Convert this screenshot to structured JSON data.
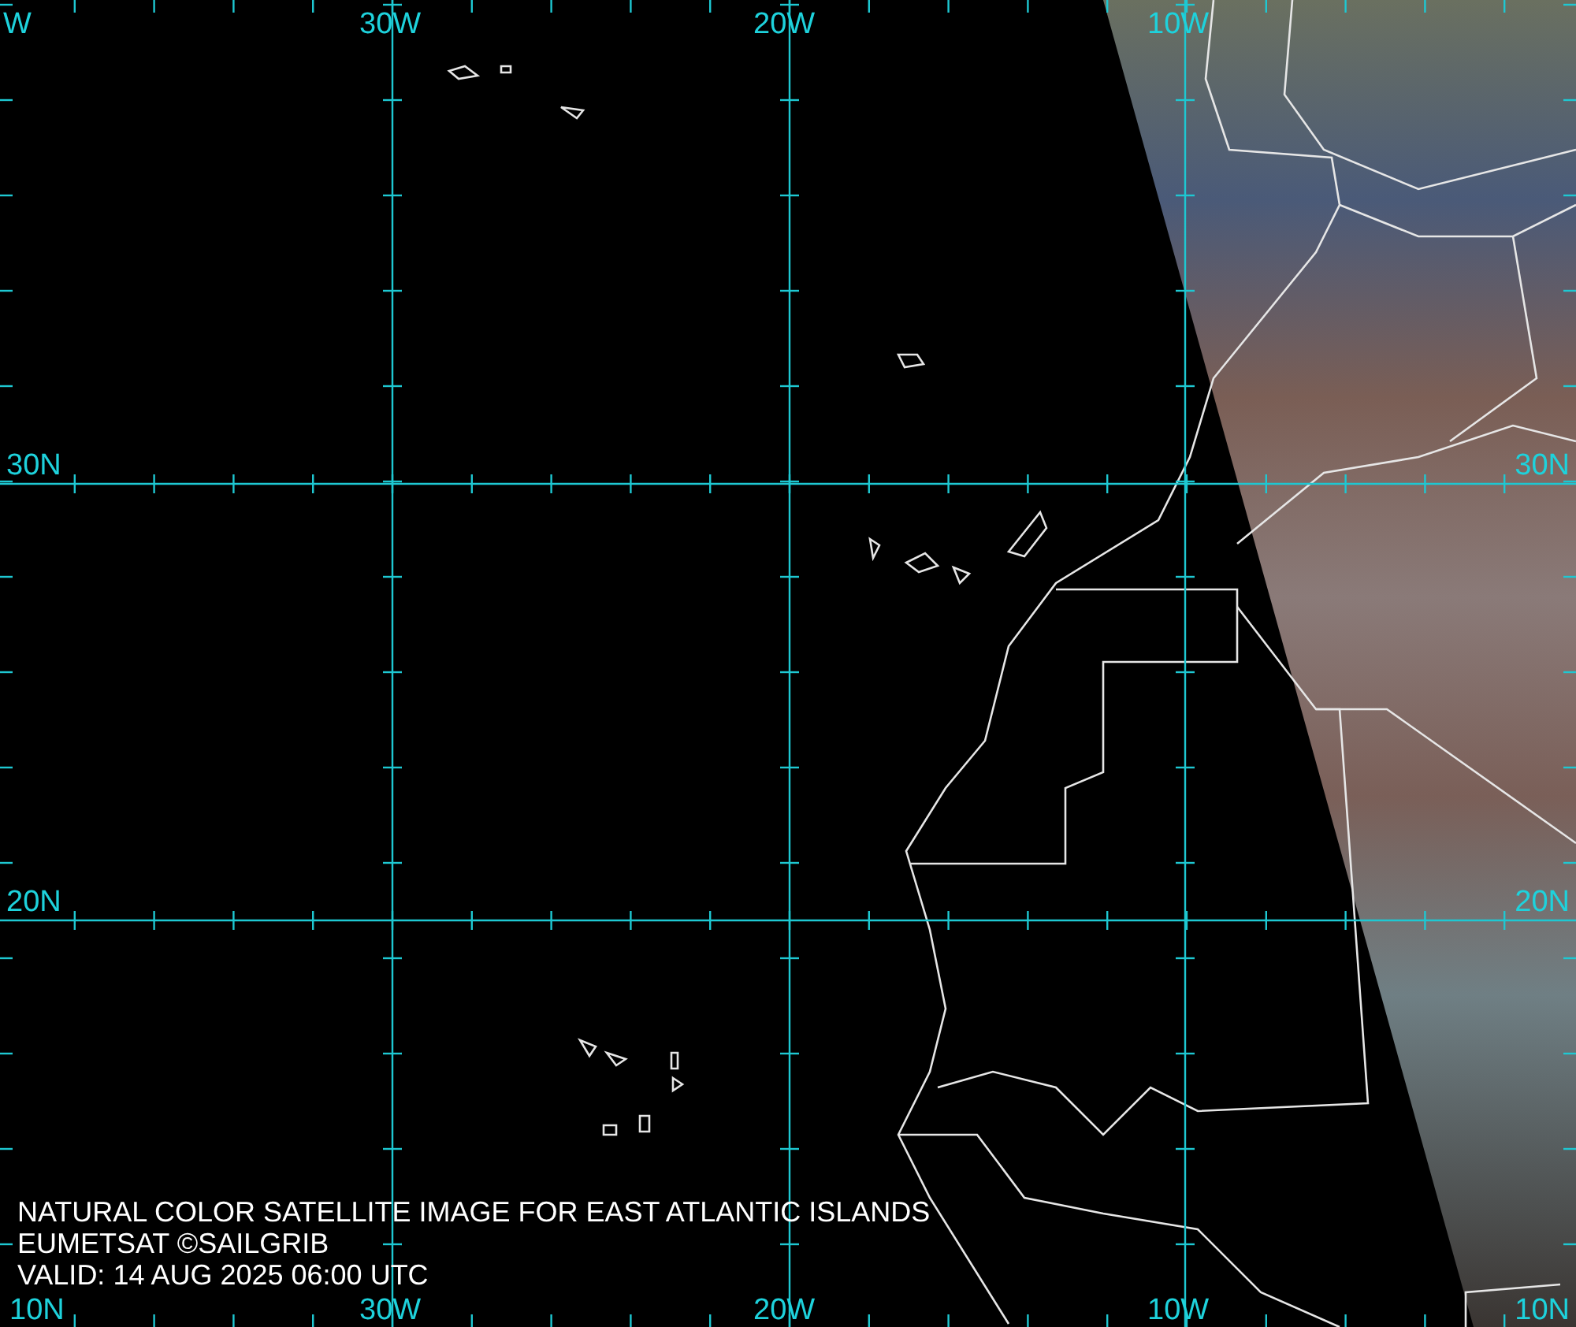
{
  "map": {
    "top_labels": [
      "W",
      "30W",
      "20W",
      "10W"
    ],
    "left_labels": [
      "30N",
      "20N"
    ],
    "right_labels": [
      "30N",
      "20N"
    ],
    "bottom_labels": [
      "10N",
      "30W",
      "20W",
      "10W",
      "10N"
    ]
  },
  "caption": [
    "NATURAL COLOR SATELLITE IMAGE FOR EAST ATLANTIC ISLANDS",
    "EUMETSAT ©SAILGRIB",
    "VALID:  14 AUG 2025 06:00 UTC"
  ]
}
